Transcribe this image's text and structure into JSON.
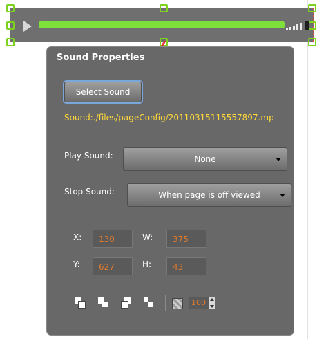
{
  "player": {
    "progress_percent": 100,
    "play_icon": "play-icon",
    "volume_icon": "volume-icon",
    "volume_level": "max"
  },
  "panel": {
    "title": "Sound Properties",
    "select_sound_label": "Select Sound",
    "sound_path": "Sound:./files/pageConfig/20110315115557897.mp",
    "play_sound_label": "Play Sound:",
    "play_sound_value": "None",
    "stop_sound_label": "Stop Sound:",
    "stop_sound_value": "When page is off viewed",
    "x_label": "X:",
    "x_value": "130",
    "w_label": "W:",
    "w_value": "375",
    "y_label": "Y:",
    "y_value": "627",
    "h_label": "H:",
    "h_value": "43",
    "opacity_value": "100"
  },
  "tools": [
    "bring-to-front-icon",
    "bring-forward-icon",
    "send-backward-icon",
    "send-to-back-icon",
    "opacity-icon"
  ],
  "colors": {
    "accent_green": "#7ed321",
    "progress_green": "#9bf04b",
    "path_yellow": "#ffd83a",
    "value_orange": "#e27a2b",
    "panel_bg": "#686868",
    "arrow_red": "#e53935"
  }
}
